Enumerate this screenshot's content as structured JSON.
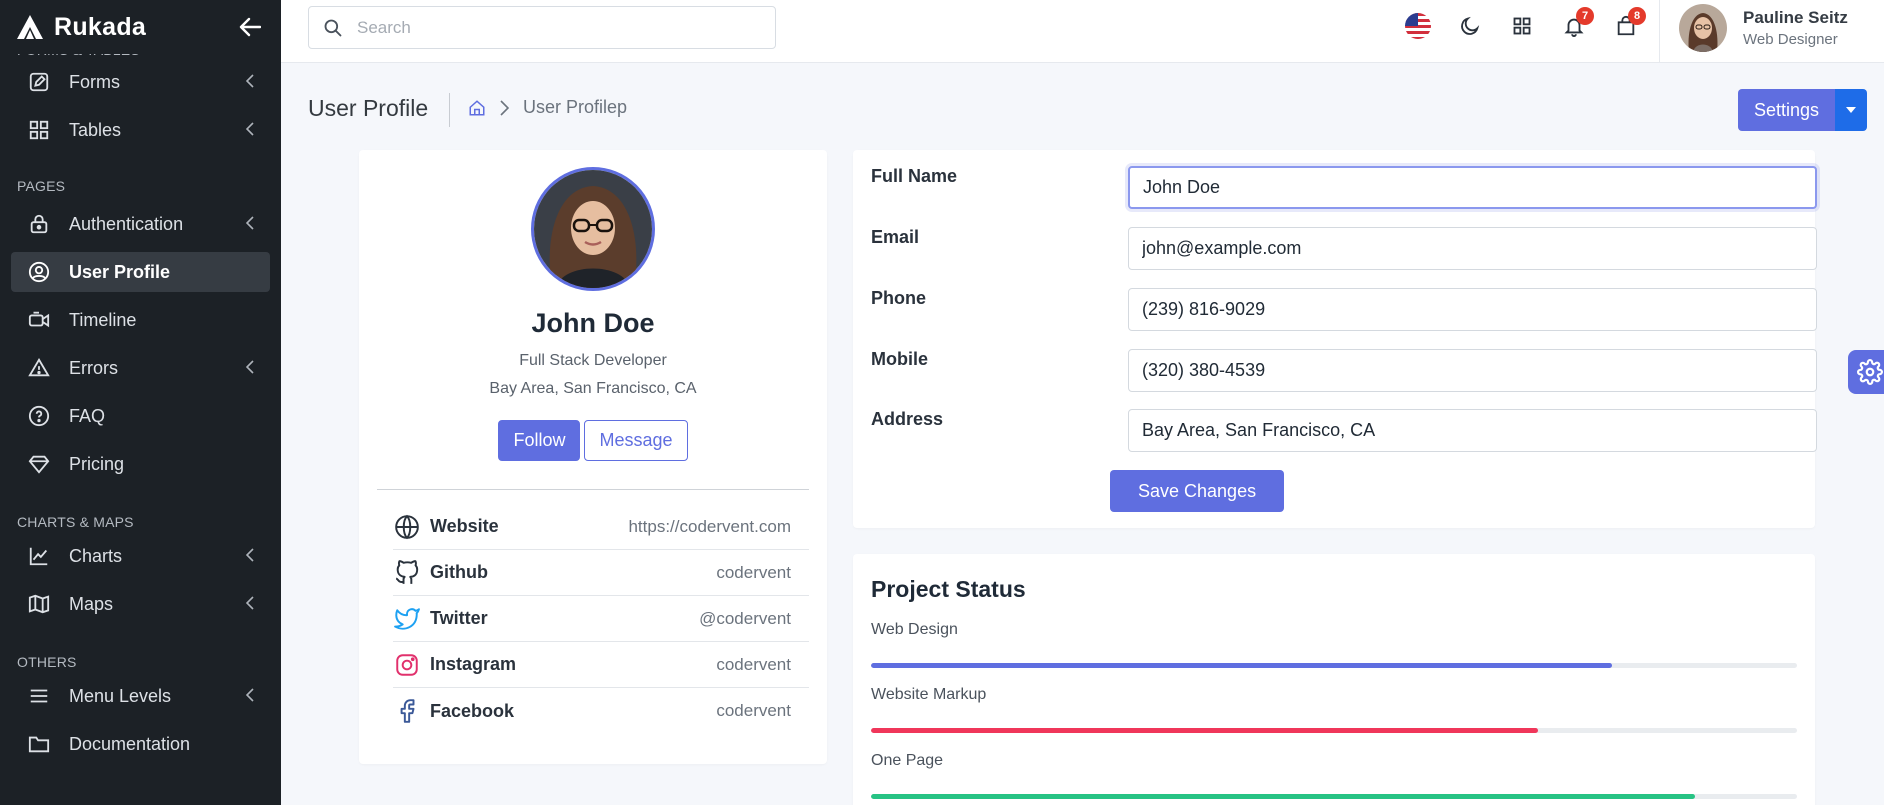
{
  "brand": {
    "name": "Rukada"
  },
  "sidebar": {
    "sections": [
      {
        "title": "FORMS & TABLES"
      },
      {
        "title": "PAGES"
      },
      {
        "title": "CHARTS & MAPS"
      },
      {
        "title": "OTHERS"
      }
    ],
    "items": [
      {
        "label": "Forms",
        "icon": "edit-icon"
      },
      {
        "label": "Tables",
        "icon": "grid-icon"
      },
      {
        "label": "Authentication",
        "icon": "lock-icon"
      },
      {
        "label": "User Profile",
        "icon": "user-circle-icon",
        "active": true
      },
      {
        "label": "Timeline",
        "icon": "video-icon"
      },
      {
        "label": "Errors",
        "icon": "alert-triangle-icon"
      },
      {
        "label": "FAQ",
        "icon": "help-circle-icon"
      },
      {
        "label": "Pricing",
        "icon": "diamond-icon"
      },
      {
        "label": "Charts",
        "icon": "trending-up-icon"
      },
      {
        "label": "Maps",
        "icon": "map-icon"
      },
      {
        "label": "Menu Levels",
        "icon": "menu-icon"
      },
      {
        "label": "Documentation",
        "icon": "folder-icon"
      }
    ]
  },
  "topbar": {
    "search_placeholder": "Search",
    "notifications_count": "7",
    "cart_count": "8",
    "user": {
      "name": "Pauline Seitz",
      "role": "Web Designer"
    }
  },
  "page": {
    "title": "User Profile",
    "breadcrumb_current": "User Profilep",
    "settings_label": "Settings"
  },
  "profile": {
    "name": "John Doe",
    "role": "Full Stack Developer",
    "location": "Bay Area, San Francisco, CA",
    "follow_label": "Follow",
    "message_label": "Message",
    "links": [
      {
        "label": "Website",
        "value": "https://codervent.com",
        "icon": "globe-icon"
      },
      {
        "label": "Github",
        "value": "codervent",
        "icon": "github-icon"
      },
      {
        "label": "Twitter",
        "value": "@codervent",
        "icon": "twitter-icon"
      },
      {
        "label": "Instagram",
        "value": "codervent",
        "icon": "instagram-icon"
      },
      {
        "label": "Facebook",
        "value": "codervent",
        "icon": "facebook-icon"
      }
    ]
  },
  "form": {
    "fields": [
      {
        "label": "Full Name",
        "value": "John Doe"
      },
      {
        "label": "Email",
        "value": "john@example.com"
      },
      {
        "label": "Phone",
        "value": "(239) 816-9029"
      },
      {
        "label": "Mobile",
        "value": "(320) 380-4539"
      },
      {
        "label": "Address",
        "value": "Bay Area, San Francisco, CA"
      }
    ],
    "save_label": "Save Changes"
  },
  "project_status": {
    "title": "Project Status",
    "items": [
      {
        "label": "Web Design",
        "percent": 80,
        "color": "#5f6ee0"
      },
      {
        "label": "Website Markup",
        "percent": 72,
        "color": "#f0365a"
      },
      {
        "label": "One Page",
        "percent": 89,
        "color": "#27c384"
      }
    ]
  },
  "colors": {
    "accent": "#5f6ee0",
    "sidebar_bg": "#1c2126",
    "badge": "#e43a2b"
  }
}
